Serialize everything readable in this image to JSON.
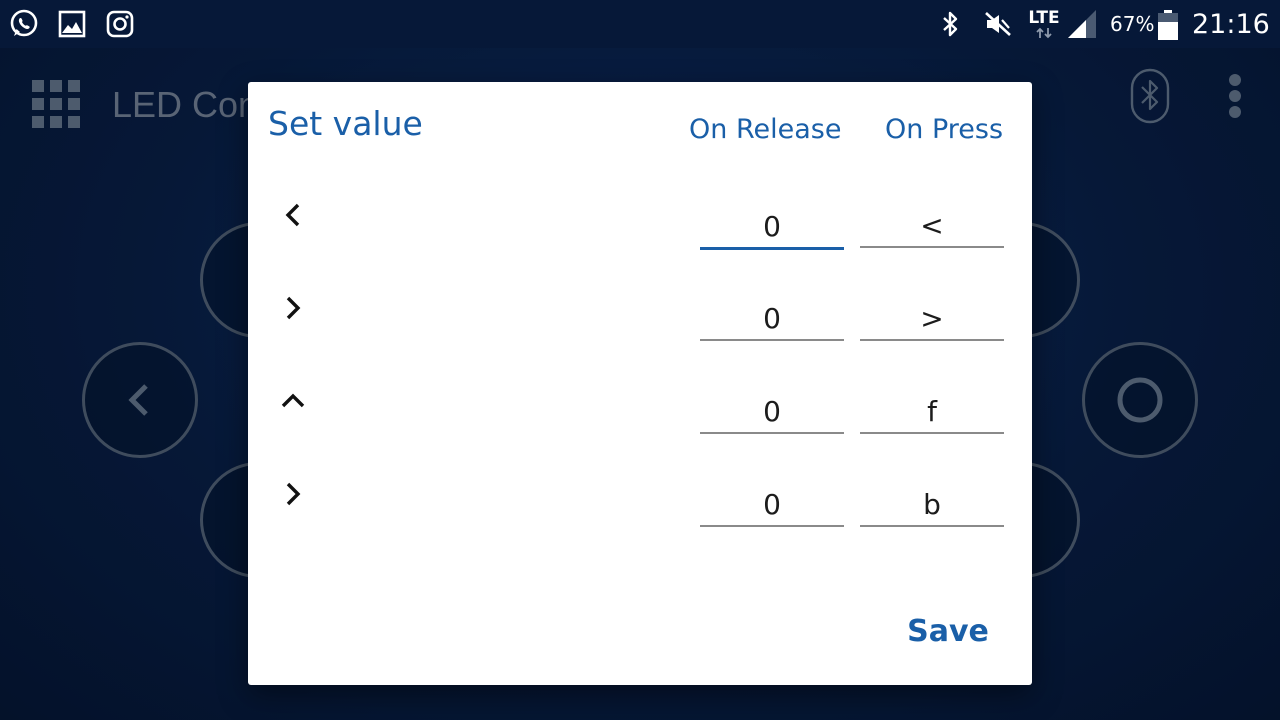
{
  "status_bar": {
    "icons_left": [
      "whatsapp-icon",
      "gallery-icon",
      "instagram-icon"
    ],
    "network_label": "LTE",
    "battery_percent": "67%",
    "battery_level": 0.67,
    "time": "21:16"
  },
  "app": {
    "title": "LED Con",
    "menu_icon": "grid-icon",
    "bluetooth_icon": "bluetooth-icon",
    "overflow_icon": "more-vert-icon"
  },
  "dialog": {
    "title": "Set value",
    "headers": {
      "release": "On Release",
      "press": "On Press"
    },
    "rows": [
      {
        "icon": "chevron-left-icon",
        "release": "0",
        "press": "<"
      },
      {
        "icon": "chevron-right-icon",
        "release": "0",
        "press": ">"
      },
      {
        "icon": "chevron-up-icon",
        "release": "0",
        "press": "f"
      },
      {
        "icon": "chevron-right-icon",
        "release": "0",
        "press": "b"
      }
    ],
    "save_label": "Save"
  },
  "colors": {
    "accent": "#1a5fa8",
    "background": "#081e44",
    "dialog": "#ffffff"
  }
}
